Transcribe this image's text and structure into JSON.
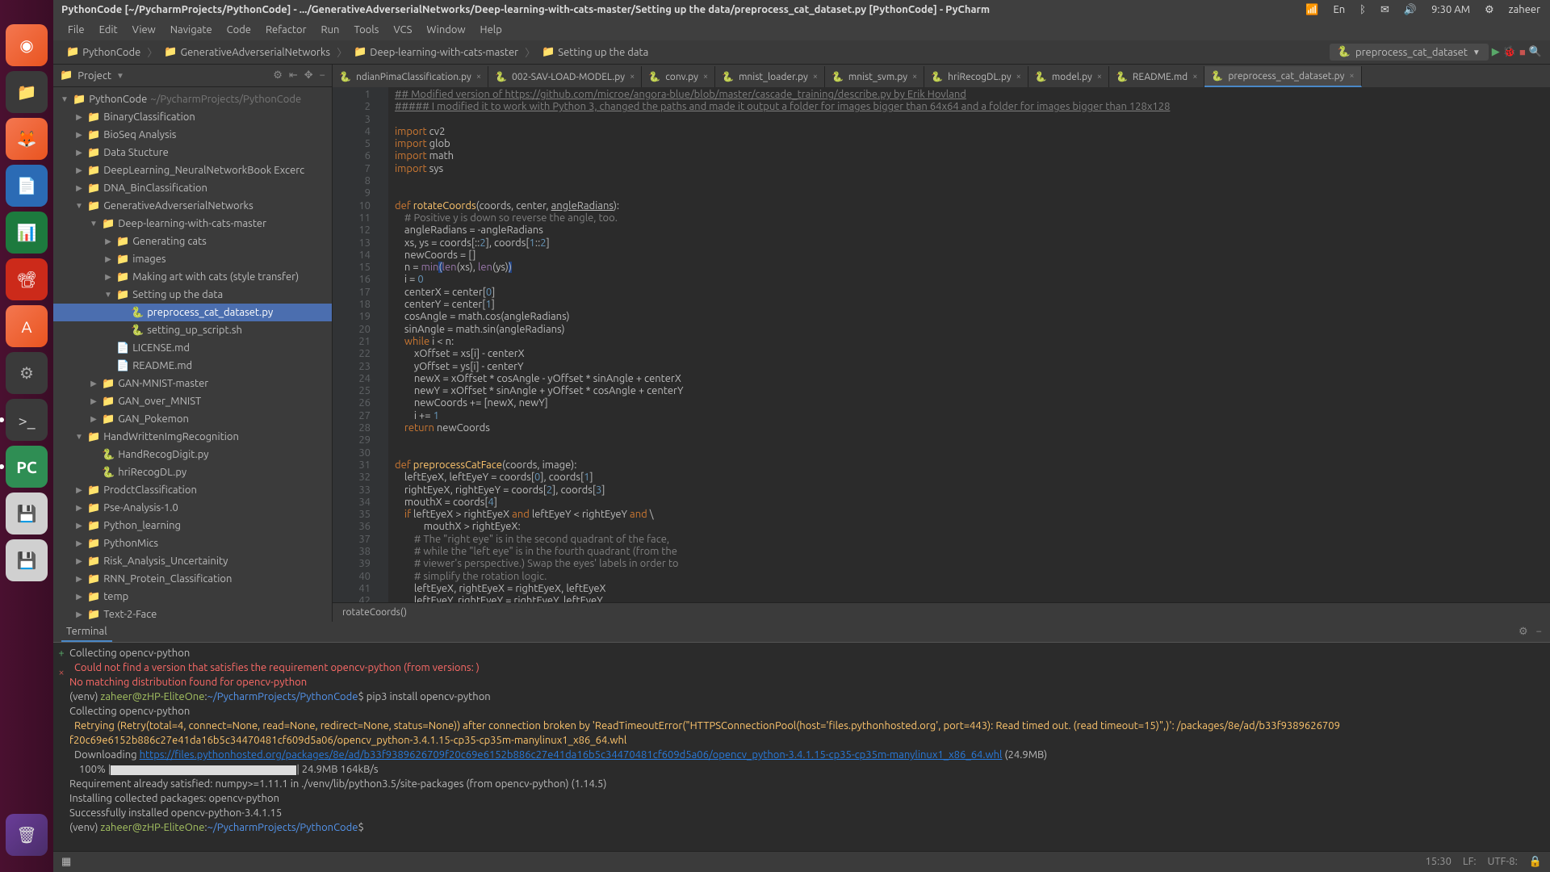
{
  "titlebar": "PythonCode [~/PycharmProjects/PythonCode] - .../GenerativeAdverserialNetworks/Deep-learning-with-cats-master/Setting up the data/preprocess_cat_dataset.py [PythonCode] - PyCharm",
  "systray": {
    "keyboard": "En",
    "time": "9:30 AM",
    "user": "zaheer"
  },
  "menu": [
    "File",
    "Edit",
    "View",
    "Navigate",
    "Code",
    "Refactor",
    "Run",
    "Tools",
    "VCS",
    "Window",
    "Help"
  ],
  "breadcrumbs": [
    "PythonCode",
    "GenerativeAdverserialNetworks",
    "Deep-learning-with-cats-master",
    "Setting up the data"
  ],
  "runconfig": "preprocess_cat_dataset",
  "project_header": "Project",
  "tree": [
    {
      "depth": 0,
      "exp": "▼",
      "icon": "📁",
      "name": "PythonCode",
      "suffix": " ~/PycharmProjects/PythonCode"
    },
    {
      "depth": 1,
      "exp": "▶",
      "icon": "📁",
      "name": "BinaryClassification"
    },
    {
      "depth": 1,
      "exp": "▶",
      "icon": "📁",
      "name": "BioSeq Analysis"
    },
    {
      "depth": 1,
      "exp": "▶",
      "icon": "📁",
      "name": "Data Stucture"
    },
    {
      "depth": 1,
      "exp": "▶",
      "icon": "📁",
      "name": "DeepLearning_NeuralNetworkBook Excerc"
    },
    {
      "depth": 1,
      "exp": "▶",
      "icon": "📁",
      "name": "DNA_BinClassification"
    },
    {
      "depth": 1,
      "exp": "▼",
      "icon": "📁",
      "name": "GenerativeAdverserialNetworks"
    },
    {
      "depth": 2,
      "exp": "▼",
      "icon": "📁",
      "name": "Deep-learning-with-cats-master"
    },
    {
      "depth": 3,
      "exp": "▶",
      "icon": "📁",
      "name": "Generating cats"
    },
    {
      "depth": 3,
      "exp": "▶",
      "icon": "📁",
      "name": "images"
    },
    {
      "depth": 3,
      "exp": "▶",
      "icon": "📁",
      "name": "Making art with cats (style transfer)"
    },
    {
      "depth": 3,
      "exp": "▼",
      "icon": "📁",
      "name": "Setting up the data"
    },
    {
      "depth": 4,
      "exp": "",
      "icon": "py",
      "name": "preprocess_cat_dataset.py",
      "sel": true
    },
    {
      "depth": 4,
      "exp": "",
      "icon": "py",
      "name": "setting_up_script.sh"
    },
    {
      "depth": 3,
      "exp": "",
      "icon": "📄",
      "name": "LICENSE.md"
    },
    {
      "depth": 3,
      "exp": "",
      "icon": "📄",
      "name": "README.md"
    },
    {
      "depth": 2,
      "exp": "▶",
      "icon": "📁",
      "name": "GAN-MNIST-master"
    },
    {
      "depth": 2,
      "exp": "▶",
      "icon": "📁",
      "name": "GAN_over_MNIST"
    },
    {
      "depth": 2,
      "exp": "▶",
      "icon": "📁",
      "name": "GAN_Pokemon"
    },
    {
      "depth": 1,
      "exp": "▼",
      "icon": "📁",
      "name": "HandWrittenImgRecognition"
    },
    {
      "depth": 2,
      "exp": "",
      "icon": "py",
      "name": "HandRecogDigit.py"
    },
    {
      "depth": 2,
      "exp": "",
      "icon": "py",
      "name": "hriRecogDL.py"
    },
    {
      "depth": 1,
      "exp": "▶",
      "icon": "📁",
      "name": "ProdctClassification"
    },
    {
      "depth": 1,
      "exp": "▶",
      "icon": "📁",
      "name": "Pse-Analysis-1.0"
    },
    {
      "depth": 1,
      "exp": "▶",
      "icon": "📁",
      "name": "Python_learning"
    },
    {
      "depth": 1,
      "exp": "▶",
      "icon": "📁",
      "name": "PythonMics"
    },
    {
      "depth": 1,
      "exp": "▶",
      "icon": "📁",
      "name": "Risk_Analysis_Uncertainity"
    },
    {
      "depth": 1,
      "exp": "▶",
      "icon": "📁",
      "name": "RNN_Protein_Classification"
    },
    {
      "depth": 1,
      "exp": "▶",
      "icon": "📁",
      "name": "temp"
    },
    {
      "depth": 1,
      "exp": "▶",
      "icon": "📁",
      "name": "Text-2-Face"
    }
  ],
  "tabs": [
    {
      "label": "ndianPimaClassification.py"
    },
    {
      "label": "002-SAV-LOAD-MODEL.py"
    },
    {
      "label": "conv.py"
    },
    {
      "label": "mnist_loader.py"
    },
    {
      "label": "mnist_svm.py"
    },
    {
      "label": "hriRecogDL.py"
    },
    {
      "label": "model.py"
    },
    {
      "label": "README.md"
    },
    {
      "label": "preprocess_cat_dataset.py",
      "active": true
    }
  ],
  "code_lines_start": 1,
  "code_lines_end": 43,
  "editor_breadcrumb": "rotateCoords()",
  "code": {
    "l1": "## Modified version of https://github.com/microe/angora-blue/blob/master/cascade_training/describe.py by Erik Hovland",
    "l2": "##### I modified it to work with Python 3, changed the paths and made it output a folder for images bigger than 64x64 and a folder for images bigger than 128x128",
    "l4a": "import",
    "l4b": " cv2",
    "l5a": "import",
    "l5b": " glob",
    "l6a": "import",
    "l6b": " math",
    "l7a": "import",
    "l7b": " sys",
    "l10a": "def ",
    "l10b": "rotateCoords",
    "l10c": "(coords, center, ",
    "l10d": "angleRadians",
    "l10e": "):",
    "l11": "    # Positive y is down so reverse the angle, too.",
    "l12": "    angleRadians = -angleRadians",
    "l13": "    xs, ys = coords[::2], coords[1::2]",
    "l14": "    newCoords = []",
    "l15a": "    n = ",
    "l15b": "min",
    "l15c": "(",
    "l15d": "len",
    "l15e": "(xs), ",
    "l15f": "len",
    "l15g": "(ys)",
    "l16": "    i = 0",
    "l17": "    centerX = center[0]",
    "l18": "    centerY = center[1]",
    "l19": "    cosAngle = math.cos(angleRadians)",
    "l20": "    sinAngle = math.sin(angleRadians)",
    "l21a": "    ",
    "l21b": "while",
    "l21c": " i < n:",
    "l22": "        xOffset = xs[i] - centerX",
    "l23": "        yOffset = ys[i] - centerY",
    "l24": "        newX = xOffset * cosAngle - yOffset * sinAngle + centerX",
    "l25": "        newY = xOffset * sinAngle + yOffset * cosAngle + centerY",
    "l26": "        newCoords += [newX, newY]",
    "l27": "        i += 1",
    "l28a": "    ",
    "l28b": "return",
    "l28c": " newCoords",
    "l31a": "def ",
    "l31b": "preprocessCatFace",
    "l31c": "(coords, image):",
    "l32": "    leftEyeX, leftEyeY = coords[0], coords[1]",
    "l33": "    rightEyeX, rightEyeY = coords[2], coords[3]",
    "l34": "    mouthX = coords[4]",
    "l35a": "    ",
    "l35b": "if",
    "l35c": " leftEyeX > rightEyeX ",
    "l35d": "and",
    "l35e": " leftEyeY < rightEyeY ",
    "l35f": "and",
    "l35g": " \\",
    "l36": "            mouthX > rightEyeX:",
    "l37": "        # The \"right eye\" is in the second quadrant of the face,",
    "l38": "        # while the \"left eye\" is in the fourth quadrant (from the",
    "l39": "        # viewer's perspective.) Swap the eyes' labels in order to",
    "l40": "        # simplify the rotation logic.",
    "l41": "        leftEyeX, rightEyeX = rightEyeX, leftEyeX",
    "l42": "        leftEyeY, rightEyeY = rightEyeY, leftEyeY"
  },
  "terminal_label": "Terminal",
  "terminal": {
    "l1": "Collecting opencv-python",
    "l2": "  Could not find a version that satisfies the requirement opencv-python (from versions: )",
    "l3": "No matching distribution found for opencv-python",
    "l4a": "(venv) ",
    "l4b": "zaheer@zHP-EliteOne",
    "l4c": ":",
    "l4d": "~/PycharmProjects/PythonCode",
    "l4e": "$ pip3 install opencv-python",
    "l5": "Collecting opencv-python",
    "l6": "  Retrying (Retry(total=4, connect=None, read=None, redirect=None, status=None)) after connection broken by 'ReadTimeoutError(\"HTTPSConnectionPool(host='files.pythonhosted.org', port=443): Read timed out. (read timeout=15)\",)': /packages/8e/ad/b33f9389626709",
    "l6b": "f20c69e6152b886c27e41da16b5c34470481cf609d5a06/opencv_python-3.4.1.15-cp35-cp35m-manylinux1_x86_64.whl",
    "l7a": "  Downloading ",
    "l7b": "https://files.pythonhosted.org/packages/8e/ad/b33f9389626709f20c69e6152b886c27e41da16b5c34470481cf609d5a06/opencv_python-3.4.1.15-cp35-cp35m-manylinux1_x86_64.whl",
    "l7c": " (24.9MB)",
    "l8a": "    100% |",
    "l8b": "| 24.9MB 164kB/s ",
    "l9": "Requirement already satisfied: numpy>=1.11.1 in ./venv/lib/python3.5/site-packages (from opencv-python) (1.14.5)",
    "l10": "Installing collected packages: opencv-python",
    "l11": "Successfully installed opencv-python-3.4.1.15",
    "l12a": "(venv) ",
    "l12b": "zaheer@zHP-EliteOne",
    "l12c": ":",
    "l12d": "~/PycharmProjects/PythonCode",
    "l12e": "$"
  },
  "status": {
    "pos": "15:30",
    "lf": "LF:",
    "enc": "UTF-8:"
  }
}
